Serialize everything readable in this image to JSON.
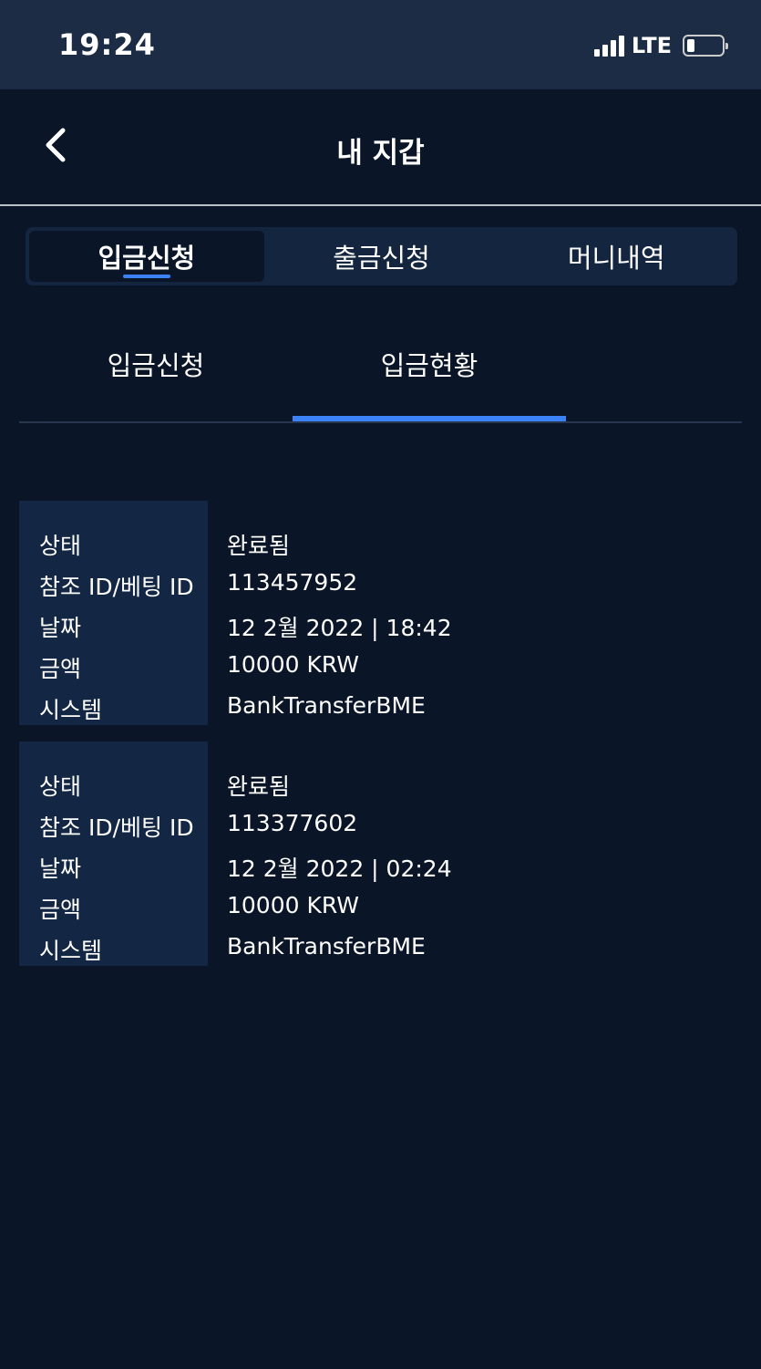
{
  "status_bar": {
    "time": "19:24",
    "network": "LTE",
    "battery_level": 0.2
  },
  "header": {
    "title": "내 지갑",
    "back_icon": "chevron-left-icon"
  },
  "main_tabs": [
    {
      "label": "입금신청",
      "active": true
    },
    {
      "label": "출금신청",
      "active": false
    },
    {
      "label": "머니내역",
      "active": false
    }
  ],
  "sub_tabs": [
    {
      "label": "입금신청",
      "active": false
    },
    {
      "label": "입금현황",
      "active": true
    }
  ],
  "colors": {
    "background": "#0a1628",
    "accent": "#3b82f6",
    "panel": "#132643"
  },
  "records": [
    {
      "rows": [
        {
          "label": "상태",
          "value": "완료됨"
        },
        {
          "label": "참조 ID/베팅 ID",
          "value": "113457952"
        },
        {
          "label": "날짜",
          "value": "12 2월 2022 | 18:42"
        },
        {
          "label": "금액",
          "value": "10000 KRW"
        },
        {
          "label": "시스템",
          "value": "BankTransferBME"
        }
      ]
    },
    {
      "rows": [
        {
          "label": "상태",
          "value": "완료됨"
        },
        {
          "label": "참조 ID/베팅 ID",
          "value": "113377602"
        },
        {
          "label": "날짜",
          "value": "12 2월 2022 | 02:24"
        },
        {
          "label": "금액",
          "value": "10000 KRW"
        },
        {
          "label": "시스템",
          "value": "BankTransferBME"
        }
      ]
    }
  ]
}
